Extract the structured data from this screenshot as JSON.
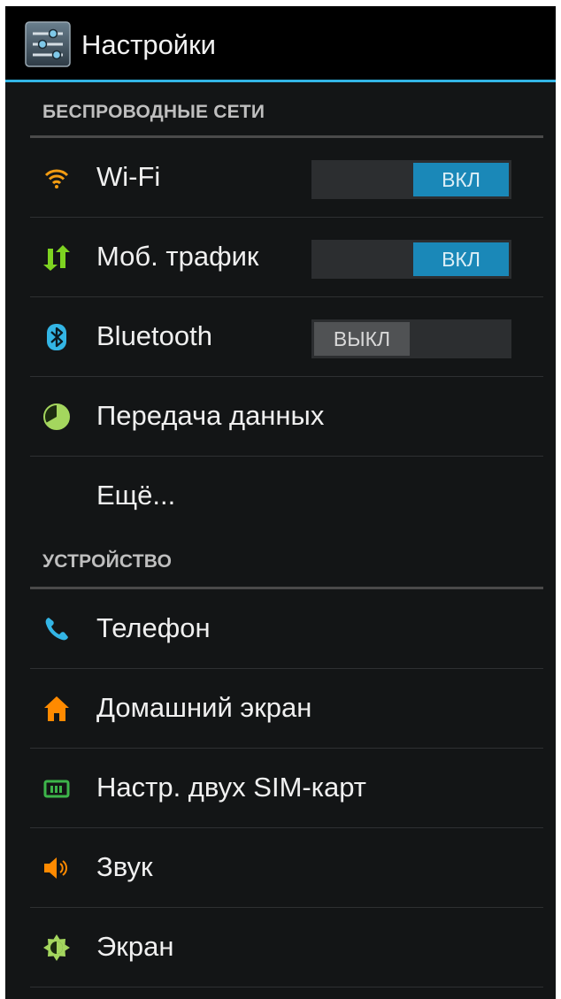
{
  "app": {
    "title": "Настройки"
  },
  "sections": {
    "wireless": "БЕСПРОВОДНЫЕ СЕТИ",
    "device": "УСТРОЙСТВО"
  },
  "wireless_items": {
    "wifi": {
      "label": "Wi-Fi",
      "toggle": "ВКЛ",
      "state": "on"
    },
    "mobile": {
      "label": "Моб. трафик",
      "toggle": "ВКЛ",
      "state": "on"
    },
    "bluetooth": {
      "label": "Bluetooth",
      "toggle": "ВЫКЛ",
      "state": "off"
    },
    "data_usage": {
      "label": "Передача данных"
    },
    "more": {
      "label": "Ещё..."
    }
  },
  "device_items": {
    "phone": {
      "label": "Телефон"
    },
    "home": {
      "label": "Домашний экран"
    },
    "sim": {
      "label": "Настр. двух SIM-карт"
    },
    "sound": {
      "label": "Звук"
    },
    "display": {
      "label": "Экран"
    }
  },
  "colors": {
    "accent": "#33b5e5",
    "toggle_on": "#1a88b8",
    "wifi_icon": "#f39c12",
    "mobile_icon": "#7ed321",
    "bluetooth_icon": "#33b5e5",
    "data_icon": "#a4d65e",
    "phone_icon": "#33b5e5",
    "home_icon": "#ff8a00",
    "sim_icon": "#3db54a",
    "sound_icon": "#ff8a00",
    "display_icon": "#a4d65e"
  },
  "icons": {
    "app": "settings-sliders-icon",
    "wifi": "wifi-icon",
    "mobile": "data-arrows-icon",
    "bluetooth": "bluetooth-icon",
    "data_usage": "pie-chart-icon",
    "phone": "phone-icon",
    "home": "home-icon",
    "sim": "sim-card-icon",
    "sound": "speaker-icon",
    "display": "brightness-icon"
  }
}
